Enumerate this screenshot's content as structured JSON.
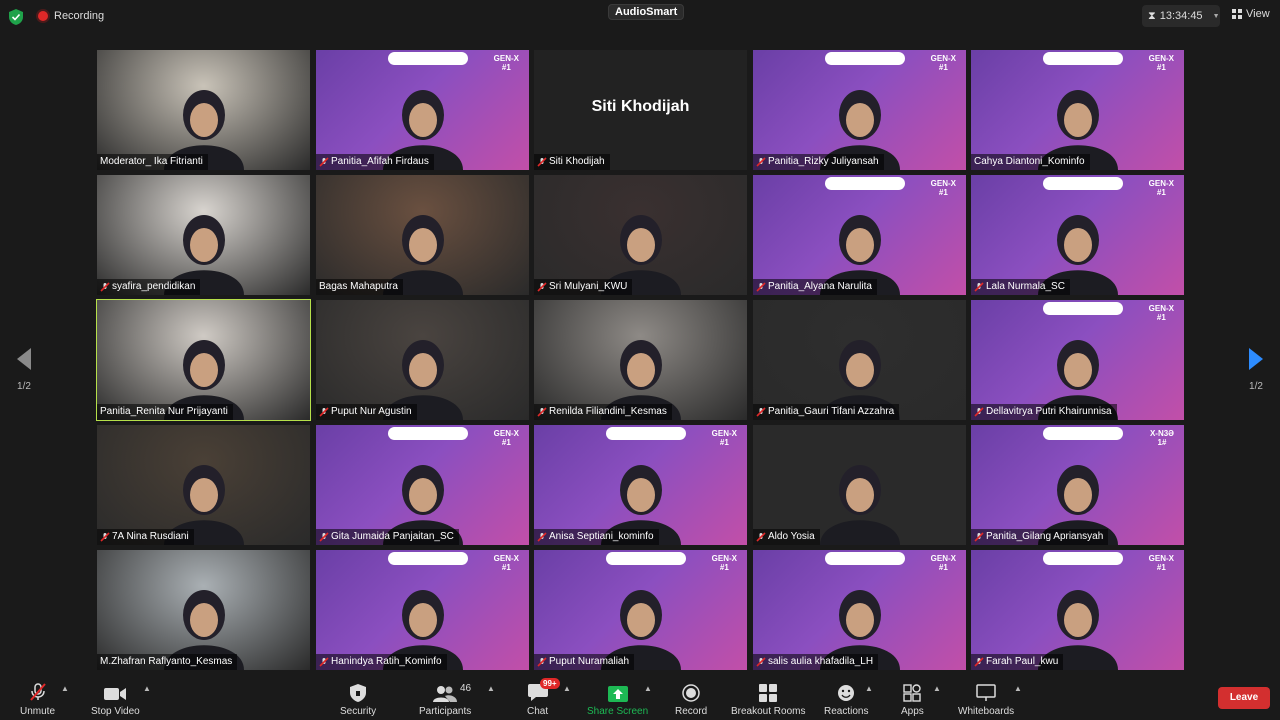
{
  "topbar": {
    "recording_label": "Recording",
    "app_badge": "AudioSmart",
    "timer": "13:34:45",
    "view_label": "View"
  },
  "pagination": {
    "left": "1/2",
    "right": "1/2"
  },
  "tiles": [
    {
      "name": "Moderator_ Ika Fitrianti",
      "muted": false
    },
    {
      "name": "Panitia_Afifah Firdaus",
      "muted": true,
      "banner": "GEN-X\n#1"
    },
    {
      "name": "Siti Khodijah",
      "muted": true,
      "big": "Siti Khodijah"
    },
    {
      "name": "Panitia_Rizky Juliyansah",
      "muted": true,
      "banner": "GEN-X\n#1"
    },
    {
      "name": "Cahya Diantoni_Kominfo",
      "muted": false,
      "banner": "GEN-X\n#1"
    },
    {
      "name": "syafira_pendidikan",
      "muted": true
    },
    {
      "name": "Bagas Mahaputra",
      "muted": false
    },
    {
      "name": "Sri Mulyani_KWU",
      "muted": true
    },
    {
      "name": "Panitia_Alyana Narulita",
      "muted": true,
      "banner": "GEN-X\n#1"
    },
    {
      "name": "Lala Nurmala_SC",
      "muted": true,
      "banner": "GEN-X\n#1"
    },
    {
      "name": "Panitia_Renita Nur Prijayanti",
      "muted": false
    },
    {
      "name": "Puput Nur Agustin",
      "muted": true
    },
    {
      "name": "Renilda Filiandini_Kesmas",
      "muted": true
    },
    {
      "name": "Panitia_Gauri Tifani Azzahra",
      "muted": true
    },
    {
      "name": "Dellavitrya Putri Khairunnisa",
      "muted": true,
      "banner": "GEN-X\n#1"
    },
    {
      "name": "7A Nina Rusdiani",
      "muted": true
    },
    {
      "name": "Gita Jumaida Panjaitan_SC",
      "muted": true,
      "banner": "GEN-X\n#1"
    },
    {
      "name": "Anisa Septiani_kominfo",
      "muted": true,
      "banner": "GEN-X\n#1"
    },
    {
      "name": "Aldo Yosia",
      "muted": true
    },
    {
      "name": "Panitia_Gilang Apriansyah",
      "muted": true,
      "banner": "X-N3Ə\n1#"
    },
    {
      "name": "M.Zhafran Raflyanto_Kesmas",
      "muted": false
    },
    {
      "name": "Hanindya Ratih_Kominfo",
      "muted": true,
      "banner": "GEN-X\n#1"
    },
    {
      "name": "Puput Nuramaliah",
      "muted": true,
      "banner": "GEN-X\n#1"
    },
    {
      "name": "salis aulia khafadila_LH",
      "muted": true,
      "banner": "GEN-X\n#1"
    },
    {
      "name": "Farah Paul_kwu",
      "muted": true,
      "banner": "GEN-X\n#1"
    }
  ],
  "toolbar": {
    "unmute": "Unmute",
    "stop_video": "Stop Video",
    "security": "Security",
    "participants": "Participants",
    "participants_count": "46",
    "chat": "Chat",
    "chat_badge": "99+",
    "share_screen": "Share Screen",
    "record": "Record",
    "breakout": "Breakout Rooms",
    "reactions": "Reactions",
    "apps": "Apps",
    "whiteboards": "Whiteboards",
    "leave": "Leave"
  },
  "colors": {
    "share_green": "#1db954",
    "leave_red": "#d32f2f",
    "active_border": "#b6e04a",
    "banner_purple": "#7a3fb0"
  }
}
